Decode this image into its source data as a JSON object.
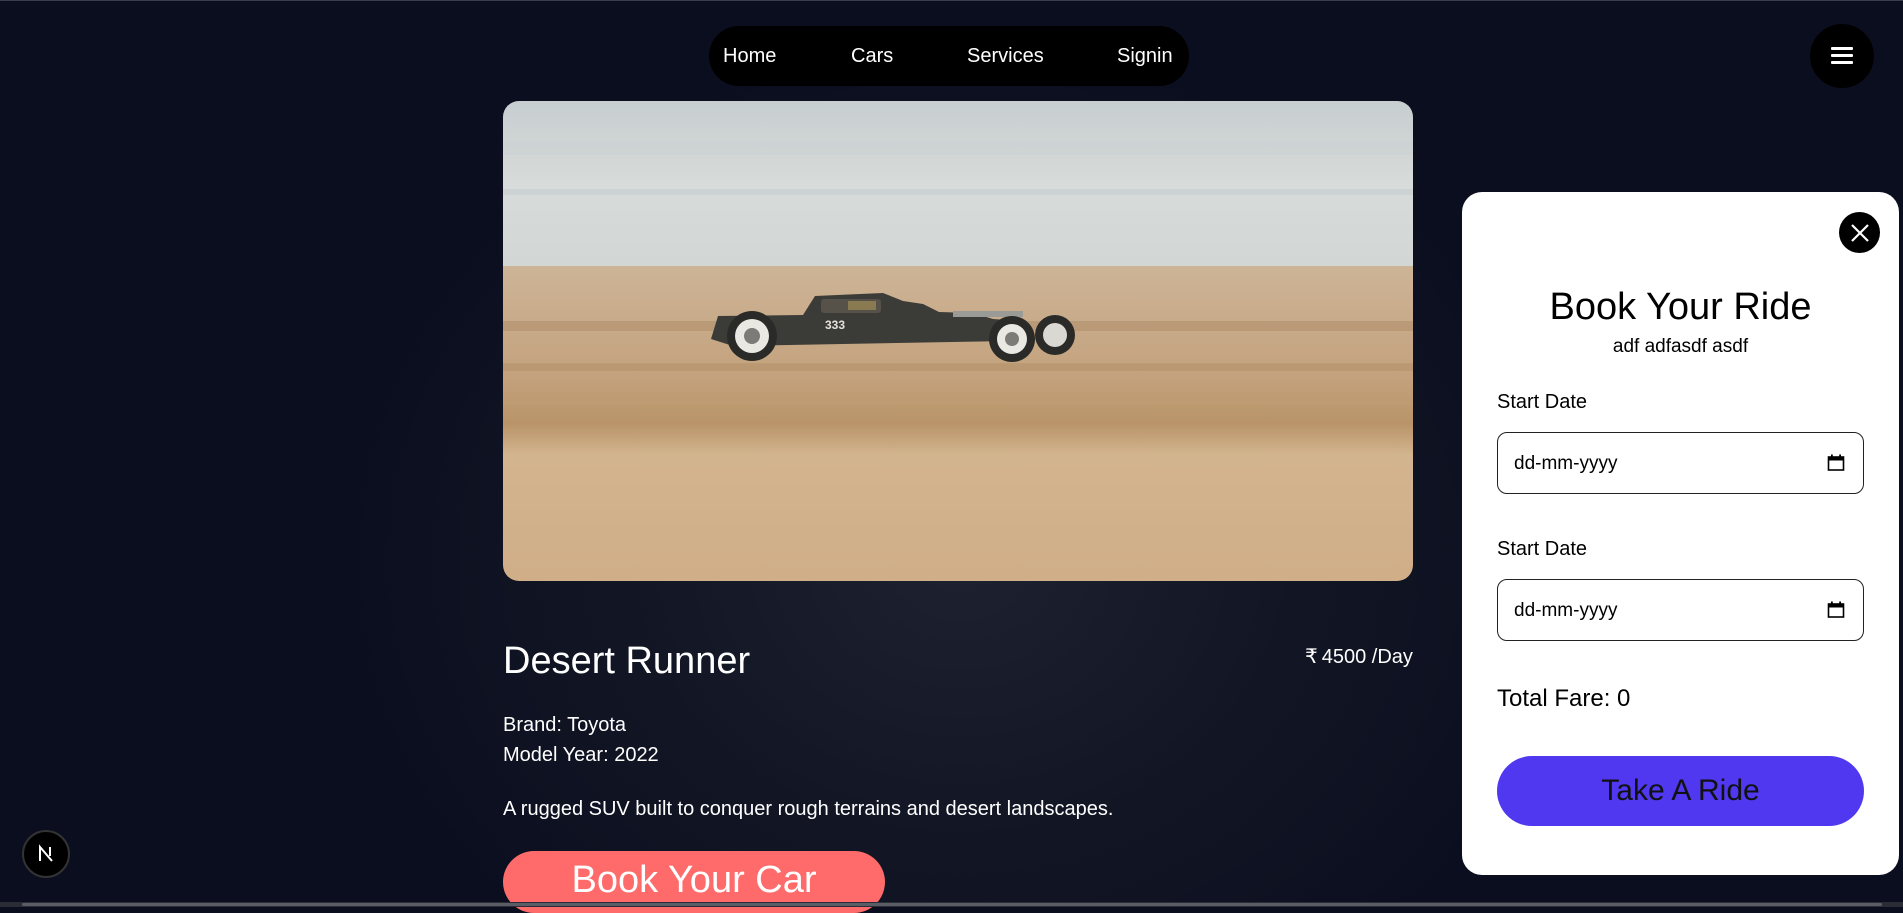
{
  "nav": {
    "items": [
      {
        "label": "Home"
      },
      {
        "label": "Cars"
      },
      {
        "label": "Services"
      },
      {
        "label": "Signin"
      }
    ],
    "menu_icon": "hamburger-icon"
  },
  "hero": {
    "image": "vintage-hot-rod-on-beach",
    "car_number": "333"
  },
  "car": {
    "title": "Desert Runner",
    "currency_symbol": "₹",
    "price": "4500 /Day",
    "brand": "Brand: Toyota",
    "model_year": "Model Year: 2022",
    "description": "A rugged SUV built to conquer rough terrains and desert landscapes.",
    "book_label": "Book Your Car"
  },
  "booking_panel": {
    "close_icon": "close-icon",
    "title": "Book Your Ride",
    "subtitle": "adf adfasdf asdf",
    "start_label_1": "Start Date",
    "start_value_1": "dd-mm-yyyy",
    "start_label_2": "Start Date",
    "start_value_2": "dd-mm-yyyy",
    "total_fare": "Total Fare: 0",
    "take_ride_label": "Take A Ride"
  },
  "badge": {
    "letter": "N"
  },
  "colors": {
    "book_button": "#ff6b6b",
    "take_ride_button": "#4f38f0",
    "nav_background": "#000000",
    "page_background": "#0a0e1f"
  }
}
